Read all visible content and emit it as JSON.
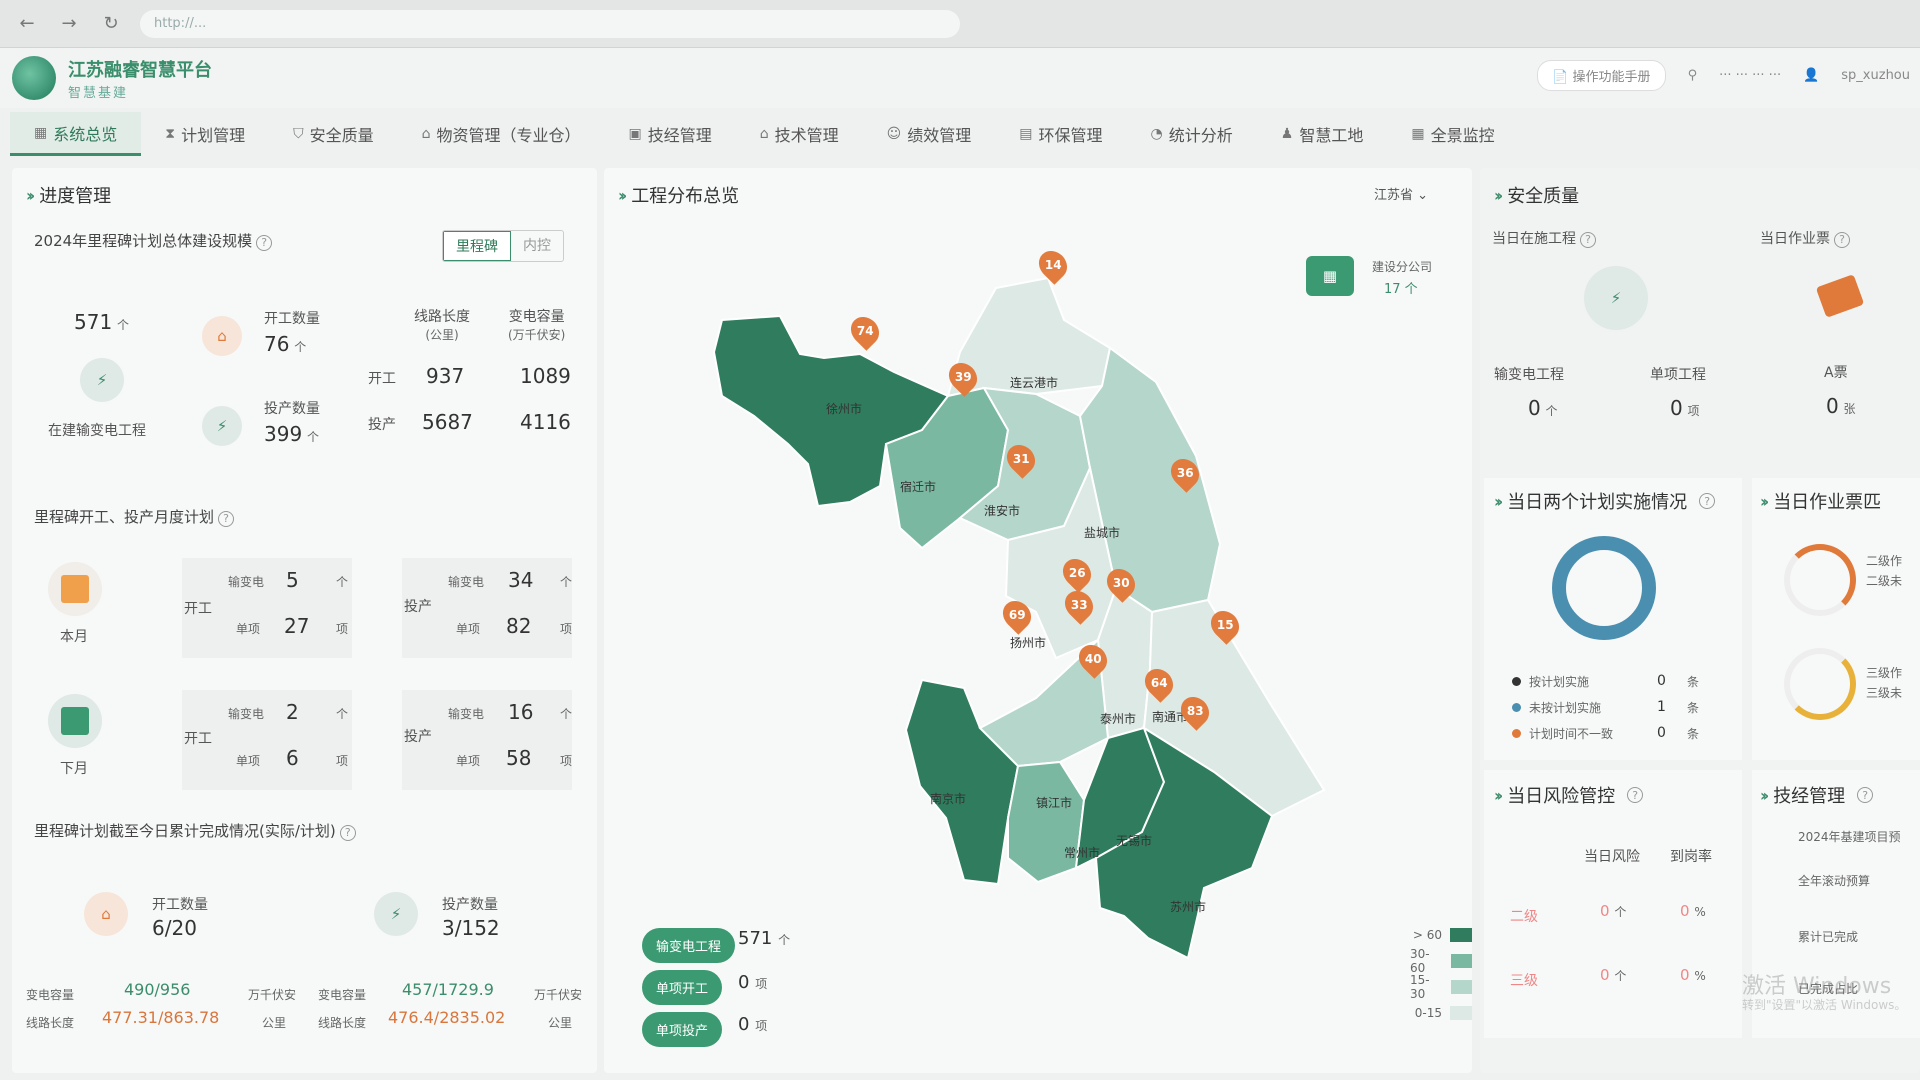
{
  "browser": {
    "url_text": "http://..."
  },
  "header": {
    "logo_line1": "江苏融睿智慧平台",
    "logo_line2": "智慧基建",
    "manual_button": "操作功能手册",
    "user_org": "··· ··· ··· ···",
    "user_name": "sp_xuzhou"
  },
  "menu": [
    {
      "label": "系统总览",
      "icon": "dashboard-icon"
    },
    {
      "label": "计划管理",
      "icon": "hourglass-icon"
    },
    {
      "label": "安全质量",
      "icon": "shield-icon"
    },
    {
      "label": "物资管理（专业仓）",
      "icon": "warehouse-icon"
    },
    {
      "label": "技经管理",
      "icon": "calculator-icon"
    },
    {
      "label": "技术管理",
      "icon": "building-icon"
    },
    {
      "label": "绩效管理",
      "icon": "person-icon"
    },
    {
      "label": "环保管理",
      "icon": "document-icon"
    },
    {
      "label": "统计分析",
      "icon": "pie-icon"
    },
    {
      "label": "智慧工地",
      "icon": "worker-icon"
    },
    {
      "label": "全景监控",
      "icon": "grid-icon"
    }
  ],
  "progress": {
    "title": "进度管理",
    "scale_title": "2024年里程碑计划总体建设规模",
    "toggle_milestone": "里程碑",
    "toggle_internal": "内控",
    "total": "571",
    "total_unit": "个",
    "under_construction_label": "在建输变电工程",
    "start_label": "开工数量",
    "start_value": "76",
    "start_unit": "个",
    "prod_label": "投产数量",
    "prod_value": "399",
    "prod_unit": "个",
    "line_length_label": "线路长度",
    "line_length_unit": "(公里)",
    "capacity_label": "变电容量",
    "capacity_unit": "(万千伏安)",
    "row_start": "开工",
    "row_prod": "投产",
    "start_line": "937",
    "start_cap": "1089",
    "prod_line": "5687",
    "prod_cap": "4116",
    "monthly_title": "里程碑开工、投产月度计划",
    "this_month": "本月",
    "next_month": "下月",
    "kaigong": "开工",
    "touchan": "投产",
    "shudian": "输变电",
    "danxiang": "单项",
    "ge": "个",
    "xiang": "项",
    "this_start_trans": "5",
    "this_start_single": "27",
    "this_prod_trans": "34",
    "this_prod_single": "82",
    "next_start_trans": "2",
    "next_start_single": "6",
    "next_prod_trans": "16",
    "next_prod_single": "58",
    "cumulative_title": "里程碑计划截至今日累计完成情况(实际/计划)",
    "cum_start_label": "开工数量",
    "cum_start_value": "6/20",
    "cum_prod_label": "投产数量",
    "cum_prod_value": "3/152",
    "capacity_short": "变电容量",
    "line_short": "线路长度",
    "cum_start_cap": "490/956",
    "cum_start_line": "477.31/863.78",
    "cum_prod_cap": "457/1729.9",
    "cum_prod_line": "476.4/2835.02",
    "unit_kva": "万千伏安",
    "unit_km": "公里"
  },
  "map": {
    "title": "工程分布总览",
    "province": "江苏省",
    "company_label": "建设分公司",
    "company_value": "17 个",
    "cities": [
      "连云港市",
      "徐州市",
      "宿迁市",
      "淮安市",
      "盐城市",
      "扬州市",
      "泰州市",
      "南通市",
      "南京市",
      "镇江市",
      "常州市",
      "无锡市",
      "苏州市"
    ],
    "markers": [
      "14",
      "74",
      "39",
      "31",
      "36",
      "26",
      "30",
      "33",
      "69",
      "40",
      "64",
      "83",
      "15"
    ],
    "btn_trans": "输变电工程",
    "btn_trans_value": "571",
    "btn_trans_unit": "个",
    "btn_start": "单项开工",
    "btn_start_value": "0",
    "btn_start_unit": "项",
    "btn_prod": "单项投产",
    "btn_prod_value": "0",
    "btn_prod_unit": "项",
    "legend": [
      {
        "label": "> 60",
        "color": "#2f7d5e"
      },
      {
        "label": "30-60",
        "color": "#7ab8a2"
      },
      {
        "label": "15-30",
        "color": "#b5d6cb"
      },
      {
        "label": "0-15",
        "color": "#dde9e4"
      }
    ]
  },
  "safety": {
    "title": "安全质量",
    "today_projects": "当日在施工程",
    "today_tickets": "当日作业票",
    "trans_proj": "输变电工程",
    "single_proj": "单项工程",
    "trans_val": "0",
    "trans_unit": "个",
    "single_val": "0",
    "single_unit": "项",
    "a_ticket": "A票",
    "a_val": "0",
    "a_unit": "张",
    "two_plans_title": "当日两个计划实施情况",
    "plan_legend": [
      {
        "label": "按计划实施",
        "value": "0",
        "unit": "条",
        "color": "#333"
      },
      {
        "label": "未按计划实施",
        "value": "1",
        "unit": "条",
        "color": "#4a8fb0"
      },
      {
        "label": "计划时间不一致",
        "value": "0",
        "unit": "条",
        "color": "#e07a3a"
      }
    ],
    "ticket_match_title": "当日作业票匹",
    "ticket_lvl2": "二级作",
    "ticket_lvl2b": "二级未",
    "ticket_lvl3": "三级作",
    "ticket_lvl3b": "三级未",
    "risk_title": "当日风险管控",
    "risk_col1": "当日风险",
    "risk_col2": "到岗率",
    "lvl2": "二级",
    "lvl3": "三级",
    "risk2_val": "0",
    "risk3_val": "0",
    "risk_unit": "个",
    "rate2": "0",
    "rate3": "0",
    "pct": "%",
    "tech_title": "技经管理",
    "tech_l1": "2024年基建项目预",
    "tech_l2": "全年滚动预算",
    "tech_l3": "累计已完成",
    "tech_l4": "已完成占比",
    "watermark1": "激活 Windows",
    "watermark2": "转到\"设置\"以激活 Windows。"
  }
}
